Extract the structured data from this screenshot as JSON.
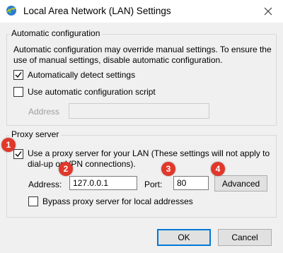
{
  "window": {
    "title": "Local Area Network (LAN) Settings"
  },
  "auto_config": {
    "legend": "Automatic configuration",
    "description_line1": "Automatic configuration may override manual settings.  To ensure the",
    "description_line2": "use of manual settings, disable automatic configuration.",
    "detect_label": "Automatically detect settings",
    "detect_checked": true,
    "script_label": "Use automatic configuration script",
    "script_checked": false,
    "address_label": "Address",
    "address_value": ""
  },
  "proxy": {
    "legend": "Proxy server",
    "use_proxy_line1": "Use a proxy server for your LAN (These settings will not apply to",
    "use_proxy_line2": "dial-up or VPN connections).",
    "use_proxy_checked": true,
    "address_label": "Address:",
    "address_value": "127.0.0.1",
    "port_label": "Port:",
    "port_value": "80",
    "advanced_label": "Advanced",
    "bypass_label": "Bypass proxy server for local addresses",
    "bypass_checked": false
  },
  "buttons": {
    "ok": "OK",
    "cancel": "Cancel"
  },
  "annotations": [
    "1",
    "2",
    "3",
    "4"
  ],
  "colors": {
    "badge": "#e0382b",
    "default_button_border": "#0078d7",
    "dialog_background": "#f0f0f0"
  }
}
